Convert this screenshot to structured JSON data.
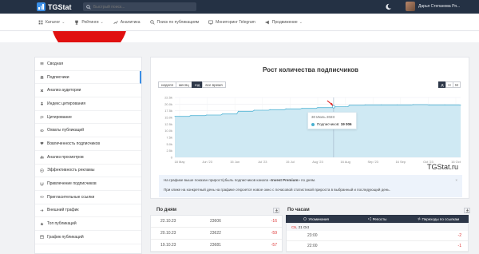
{
  "header": {
    "logo": "TGStat",
    "search_placeholder": "Быстрый поиск...",
    "user_name": "Дарья Степанова Ря..."
  },
  "nav": {
    "items": [
      {
        "label": "Каталог",
        "icon": "grid-icon",
        "caret": true
      },
      {
        "label": "Рейтинги",
        "icon": "trophy-icon",
        "caret": true
      },
      {
        "label": "Аналитика",
        "icon": "chart-icon",
        "caret": false
      },
      {
        "label": "Поиск по публикациям",
        "icon": "search-icon",
        "caret": false
      },
      {
        "label": "Мониторинг Telegram",
        "icon": "monitor-icon",
        "caret": false
      },
      {
        "label": "Продвижение",
        "icon": "megaphone-icon",
        "caret": true
      }
    ]
  },
  "sidebar": {
    "items": [
      {
        "label": "Сводная",
        "icon": "list-icon",
        "active": false
      },
      {
        "label": "Подписчики",
        "icon": "users-icon",
        "active": true
      },
      {
        "label": "Анализ аудитории",
        "icon": "x-icon",
        "active": false
      },
      {
        "label": "Индекс цитирования",
        "icon": "user-icon",
        "active": false
      },
      {
        "label": "Цитирование",
        "icon": "quote-icon",
        "active": false
      },
      {
        "label": "Охваты публикаций",
        "icon": "eye-icon",
        "active": false
      },
      {
        "label": "Вовлеченность подписчиков",
        "icon": "heart-icon",
        "active": false
      },
      {
        "label": "Анализ просмотров",
        "icon": "bar-icon",
        "active": false
      },
      {
        "label": "Эффективность рекламы",
        "icon": "target-icon",
        "active": false
      },
      {
        "label": "Привлечение подписчиков",
        "icon": "magnet-icon",
        "active": false
      },
      {
        "label": "Пригласительные ссылки",
        "icon": "link-icon",
        "active": false
      },
      {
        "label": "Внешний трафик",
        "icon": "arrow-icon",
        "active": false
      },
      {
        "label": "Топ публикаций",
        "icon": "star-icon",
        "active": false
      },
      {
        "label": "График публикаций",
        "icon": "calendar-icon",
        "active": false
      }
    ]
  },
  "main": {
    "title": "Рост количества подписчиков",
    "ranges": [
      "неделя",
      "месяц",
      "год",
      "все время"
    ],
    "selected_range": "год",
    "granularity": [
      "Д",
      "Н",
      "М"
    ],
    "selected_granularity": "Д",
    "tooltip": {
      "date": "30 Июль 2023",
      "label": "Подписчиков:",
      "value": "19 006"
    },
    "watermark": "TGStat.ru",
    "info_line1_pre": "На графике выше показан прирост/убыль подписчиков канала «",
    "info_channel": "Invest Premium",
    "info_line1_post": "» по дням.",
    "info_line2": "При клике на конкретный день на графике откроется новое окно с почасовой статистикой прироста в выбранный и последующий день.",
    "close": "×"
  },
  "colors": {
    "topbar": "#243144",
    "accent": "#3a8ee6",
    "area_fill": "#cfe9f3",
    "area_line": "#55b5d5",
    "negative": "#d33333"
  },
  "chart_data": {
    "type": "area",
    "x": [
      "18 May",
      "25 May",
      "Jun '23",
      "8 Jun",
      "15 Jun",
      "22 Jun",
      "Jul '23",
      "8 Jul",
      "15 Jul",
      "22 Jul",
      "30 Jul",
      "Aug '23",
      "8 Aug",
      "16 Aug",
      "Sep '23",
      "15 Sep",
      "Oct '23",
      "16 Oct",
      "25 Oct"
    ],
    "values": [
      15400,
      15700,
      15900,
      16300,
      17300,
      17700,
      17900,
      18200,
      18400,
      18700,
      19006,
      19600,
      19700,
      19700,
      19700,
      19800,
      19700,
      19700,
      19600
    ],
    "x_tick_labels": [
      "18 May",
      "Jun '23",
      "15 Jun",
      "Jul '23",
      "15 Jul",
      "Aug '23",
      "16 Aug",
      "Sep '23",
      "16 Sep",
      "Oct '23",
      "16 Oct"
    ],
    "y_tick_labels": [
      "0",
      "2.5k",
      "5.0k",
      "7.5k",
      "10.0k",
      "12.5k",
      "15.0k",
      "17.5k",
      "20.0k",
      "22.5k"
    ],
    "ylim": [
      0,
      22500
    ],
    "grid": true
  },
  "by_day": {
    "title": "По дням",
    "rows": [
      {
        "date": "22.10.23",
        "total": "23606",
        "change": "-16"
      },
      {
        "date": "20.10.23",
        "total": "23622",
        "change": "-59"
      },
      {
        "date": "19.10.23",
        "total": "23681",
        "change": "-57"
      }
    ]
  },
  "by_hour": {
    "title": "По часам",
    "tabs": [
      {
        "label": "Упоминания",
        "icon": "at-icon"
      },
      {
        "label": "Репосты",
        "icon": "share-icon"
      },
      {
        "label": "Переходы по ссылкам",
        "icon": "swap-icon"
      }
    ],
    "day_label": "СБ, 21 Oct",
    "day_prefix": "СБ",
    "rows": [
      {
        "time": "23:00",
        "change": "-2"
      },
      {
        "time": "22:00",
        "change": "-1"
      }
    ]
  }
}
